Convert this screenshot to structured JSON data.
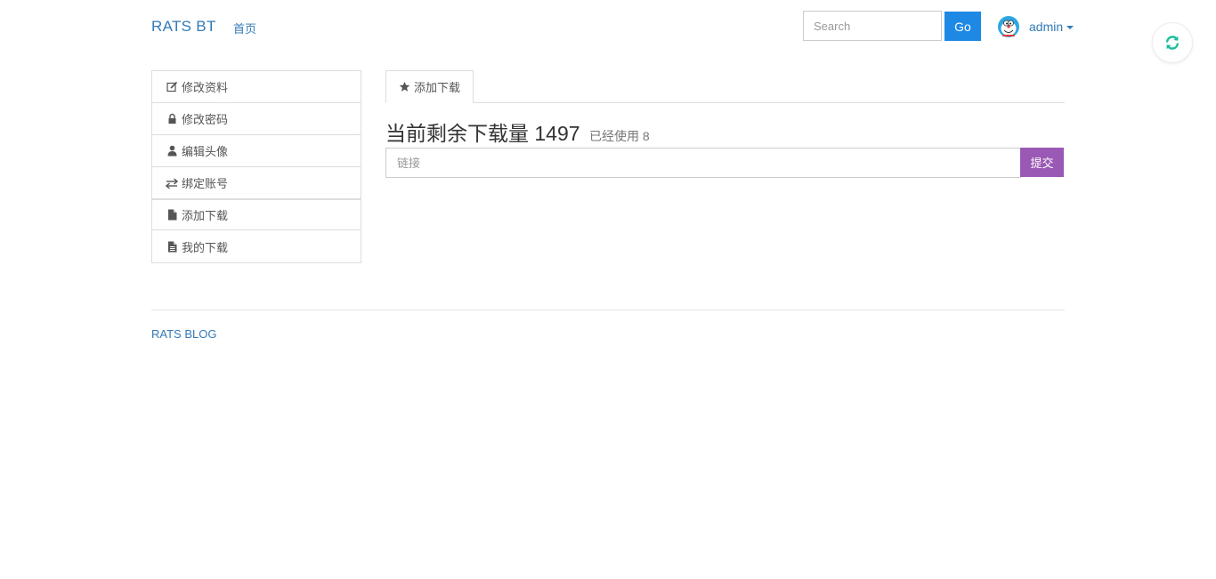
{
  "navbar": {
    "brand": "RATS BT",
    "home_label": "首页",
    "search_placeholder": "Search",
    "go_label": "Go",
    "username": "admin"
  },
  "sidebar": {
    "items": [
      {
        "label": "修改资料",
        "icon": "edit-icon"
      },
      {
        "label": "修改密码",
        "icon": "lock-icon"
      },
      {
        "label": "编辑头像",
        "icon": "user-icon"
      },
      {
        "label": "绑定账号",
        "icon": "exchange-icon"
      },
      {
        "label": "添加下载",
        "icon": "file-icon"
      },
      {
        "label": "我的下载",
        "icon": "file-text-icon"
      }
    ]
  },
  "main": {
    "tab_label": "添加下载",
    "tab_icon": "star-icon",
    "quota_label": "当前剩余下载量",
    "quota_value": "1497",
    "used_label": "已经使用",
    "used_value": "8",
    "link_placeholder": "链接",
    "submit_label": "提交"
  },
  "footer": {
    "link_label": "RATS BLOG"
  },
  "colors": {
    "link": "#337ab7",
    "go_button": "#1e88e5",
    "submit_button": "#9b59b6",
    "refresh_icon": "#1abc9c"
  }
}
